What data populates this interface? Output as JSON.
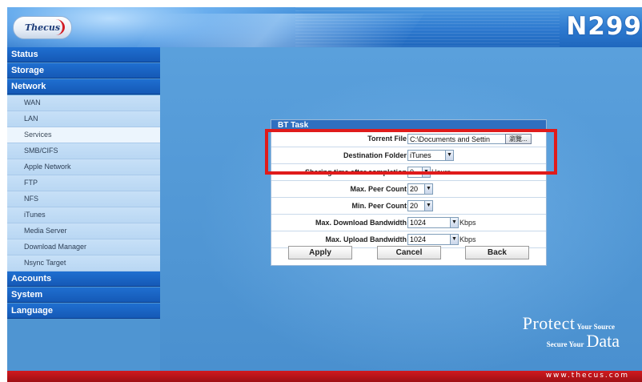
{
  "header": {
    "logo_text": "Thecus",
    "model": "N299"
  },
  "sidebar": {
    "categories": {
      "status": "Status",
      "storage": "Storage",
      "network": "Network",
      "accounts": "Accounts",
      "system": "System",
      "language": "Language"
    },
    "network_items": [
      "WAN",
      "LAN",
      "Services",
      "SMB/CIFS",
      "Apple Network",
      "FTP",
      "NFS",
      "iTunes",
      "Media Server",
      "Download Manager",
      "Nsync Target"
    ],
    "active_item": "Services"
  },
  "dialog": {
    "title": "BT Task",
    "torrent_file": {
      "label": "Torrent File",
      "value": "C:\\Documents and Settin",
      "browse_label": "瀏覽..."
    },
    "destination_folder": {
      "label": "Destination Folder",
      "value": "iTunes"
    },
    "sharing_time": {
      "label": "Sharing time after completion",
      "value": "0",
      "unit": "Hours"
    },
    "max_peer": {
      "label": "Max. Peer Count",
      "value": "20"
    },
    "min_peer": {
      "label": "Min. Peer Count",
      "value": "20"
    },
    "max_download": {
      "label": "Max. Download Bandwidth",
      "value": "1024",
      "unit": "Kbps"
    },
    "max_upload": {
      "label": "Max. Upload Bandwidth",
      "value": "1024",
      "unit": "Kbps"
    },
    "buttons": {
      "apply": "Apply",
      "cancel": "Cancel",
      "back": "Back"
    }
  },
  "slogan": {
    "protect": "Protect",
    "your_source": "Your Source",
    "secure_your": "Secure Your",
    "data": "Data"
  },
  "footer": {
    "url": "www.thecus.com"
  },
  "colors": {
    "nav_blue": "#1559b6",
    "dialog_title": "#2f6fc0",
    "highlight_red": "#e01b1b",
    "footer_red": "#d11a1f"
  }
}
